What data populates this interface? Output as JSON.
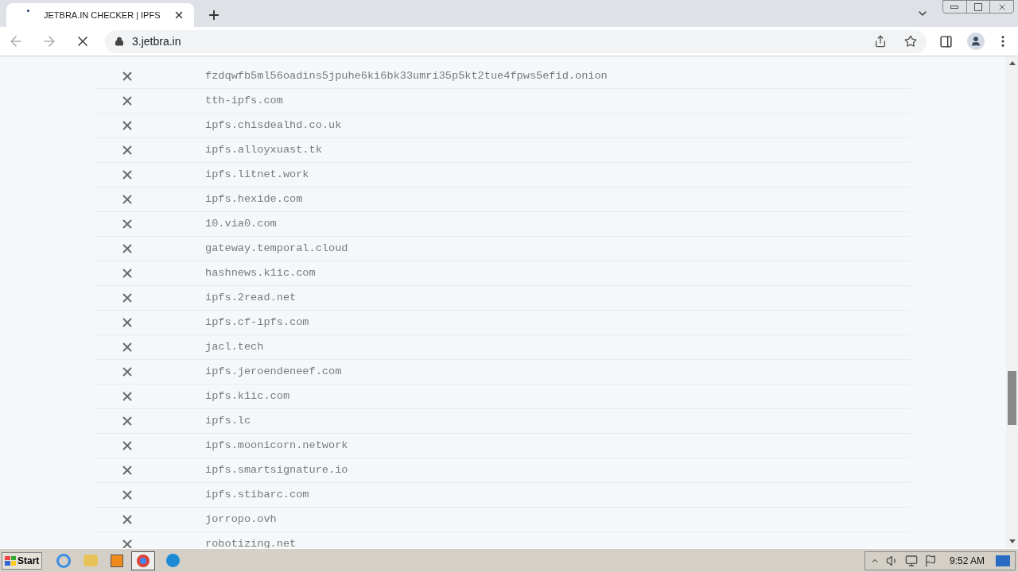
{
  "browser": {
    "tab": {
      "title": "JETBRA.IN CHECKER | IPFS",
      "selected": true
    },
    "address": "3.jetbra.in",
    "loading": true
  },
  "gateways": [
    {
      "failed": true,
      "host": "fzdqwfb5ml56oadins5jpuhe6ki6bk33umri35p5kt2tue4fpws5efid.onion"
    },
    {
      "failed": true,
      "host": "tth-ipfs.com"
    },
    {
      "failed": true,
      "host": "ipfs.chisdealhd.co.uk"
    },
    {
      "failed": true,
      "host": "ipfs.alloyxuast.tk"
    },
    {
      "failed": true,
      "host": "ipfs.litnet.work"
    },
    {
      "failed": true,
      "host": "ipfs.hexide.com"
    },
    {
      "failed": true,
      "host": "10.via0.com"
    },
    {
      "failed": true,
      "host": "gateway.temporal.cloud"
    },
    {
      "failed": true,
      "host": "hashnews.k1ic.com"
    },
    {
      "failed": true,
      "host": "ipfs.2read.net"
    },
    {
      "failed": true,
      "host": "ipfs.cf-ipfs.com"
    },
    {
      "failed": true,
      "host": "jacl.tech"
    },
    {
      "failed": true,
      "host": "ipfs.jeroendeneef.com"
    },
    {
      "failed": true,
      "host": "ipfs.k1ic.com"
    },
    {
      "failed": true,
      "host": "ipfs.lc"
    },
    {
      "failed": true,
      "host": "ipfs.moonicorn.network"
    },
    {
      "failed": true,
      "host": "ipfs.smartsignature.io"
    },
    {
      "failed": true,
      "host": "ipfs.stibarc.com"
    },
    {
      "failed": true,
      "host": "jorropo.ovh"
    },
    {
      "failed": true,
      "host": "robotizing.net"
    }
  ],
  "taskbar": {
    "start": "Start",
    "clock": "9:52 AM"
  }
}
